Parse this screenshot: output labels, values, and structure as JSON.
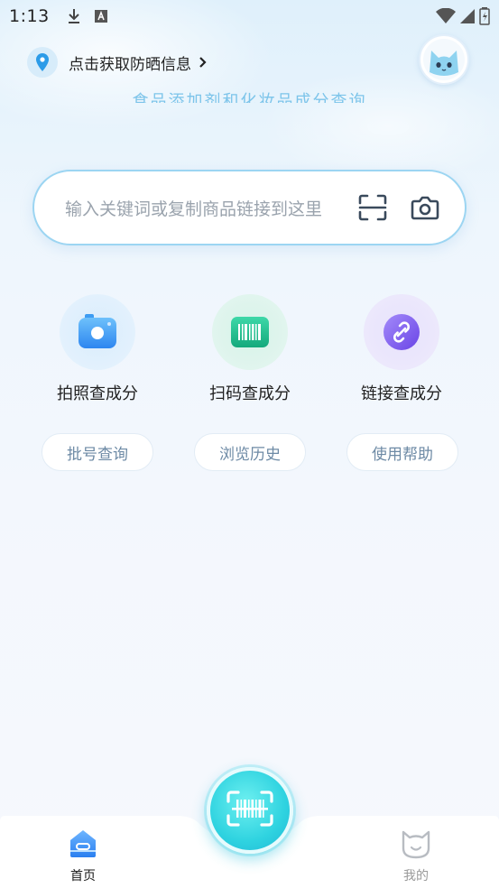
{
  "status_bar": {
    "time": "1:13"
  },
  "location": {
    "text": "点击获取防晒信息",
    "icon": "location-pin-icon"
  },
  "subtitle": "食品添加剂和化妆品成分查询",
  "search": {
    "placeholder": "输入关键词或复制商品链接到这里"
  },
  "features": [
    {
      "label": "拍照查成分",
      "icon": "camera-icon",
      "color": "#3d9cf2"
    },
    {
      "label": "扫码查成分",
      "icon": "barcode-icon",
      "color": "#1fbf8f"
    },
    {
      "label": "链接查成分",
      "icon": "link-icon",
      "color": "#7b5cf0"
    }
  ],
  "quick_links": [
    {
      "label": "批号查询"
    },
    {
      "label": "浏览历史"
    },
    {
      "label": "使用帮助"
    }
  ],
  "tabbar": {
    "home_label": "首页",
    "mine_label": "我的",
    "active_color": "#1a1a1a",
    "inactive_color": "#9a9a9a"
  },
  "colors": {
    "accent": "#2fd3e0",
    "search_border": "#9cd5f2",
    "subtitle": "#7cc4ea"
  }
}
